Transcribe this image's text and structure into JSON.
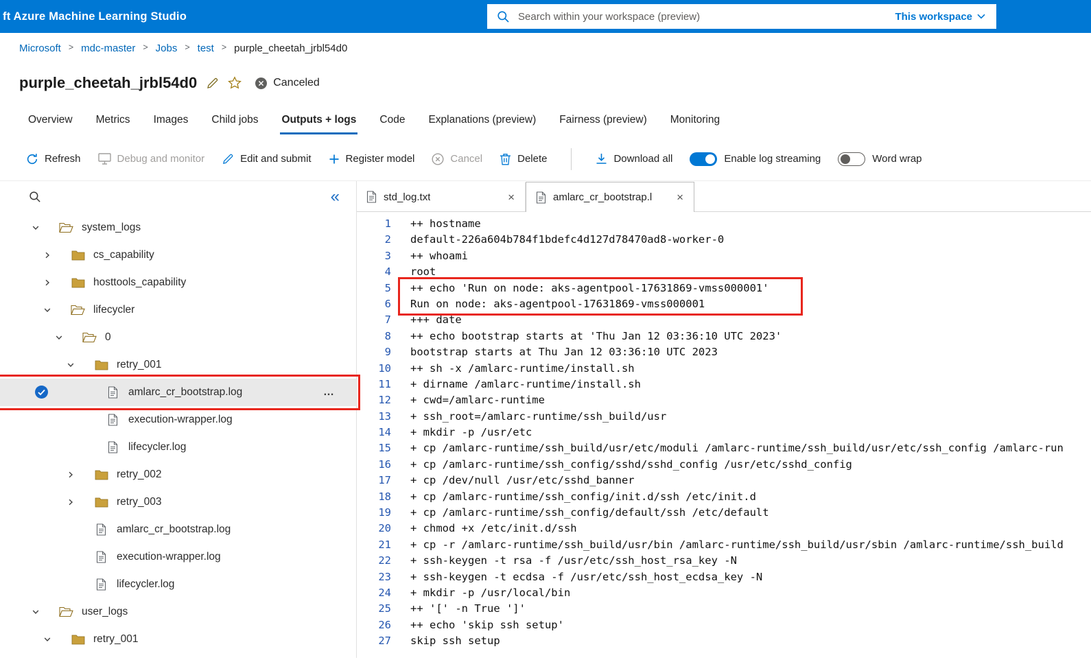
{
  "topbar": {
    "app_title": "ft Azure Machine Learning Studio",
    "search_placeholder": "Search within your workspace (preview)",
    "workspace_selector": "This workspace"
  },
  "breadcrumb": {
    "items": [
      "Microsoft",
      "mdc-master",
      "Jobs",
      "test",
      "purple_cheetah_jrbl54d0"
    ]
  },
  "header": {
    "title": "purple_cheetah_jrbl54d0",
    "status": "Canceled"
  },
  "tabs": [
    {
      "label": "Overview",
      "active": false
    },
    {
      "label": "Metrics",
      "active": false
    },
    {
      "label": "Images",
      "active": false
    },
    {
      "label": "Child jobs",
      "active": false
    },
    {
      "label": "Outputs + logs",
      "active": true
    },
    {
      "label": "Code",
      "active": false
    },
    {
      "label": "Explanations (preview)",
      "active": false
    },
    {
      "label": "Fairness (preview)",
      "active": false
    },
    {
      "label": "Monitoring",
      "active": false
    }
  ],
  "toolbar": {
    "refresh": "Refresh",
    "debug": "Debug and monitor",
    "edit": "Edit and submit",
    "register": "Register model",
    "cancel": "Cancel",
    "delete": "Delete",
    "download": "Download all",
    "log_streaming": "Enable log streaming",
    "word_wrap": "Word wrap",
    "log_streaming_on": true,
    "word_wrap_on": false
  },
  "icons": {
    "close": "×",
    "ellipsis_menu": "…",
    "collapse_double_chevron": "«",
    "breadcrumb_separator": ">"
  },
  "tree": {
    "items": [
      {
        "indent": 0,
        "chevron": "down",
        "icon": "folder",
        "open": true,
        "label": "system_logs"
      },
      {
        "indent": 1,
        "chevron": "right",
        "icon": "folder",
        "open": false,
        "label": "cs_capability"
      },
      {
        "indent": 1,
        "chevron": "right",
        "icon": "folder",
        "open": false,
        "label": "hosttools_capability"
      },
      {
        "indent": 1,
        "chevron": "down",
        "icon": "folder",
        "open": true,
        "label": "lifecycler"
      },
      {
        "indent": 2,
        "chevron": "down",
        "icon": "folder",
        "open": true,
        "label": "0"
      },
      {
        "indent": 3,
        "chevron": "down",
        "icon": "folder",
        "open": false,
        "label": "retry_001"
      },
      {
        "indent": 4,
        "chevron": "none",
        "icon": "file",
        "label": "amlarc_cr_bootstrap.log",
        "selected": true,
        "annotated": true,
        "has_menu": true
      },
      {
        "indent": 4,
        "chevron": "none",
        "icon": "file",
        "label": "execution-wrapper.log"
      },
      {
        "indent": 4,
        "chevron": "none",
        "icon": "file",
        "label": "lifecycler.log"
      },
      {
        "indent": 3,
        "chevron": "right",
        "icon": "folder",
        "open": false,
        "label": "retry_002"
      },
      {
        "indent": 3,
        "chevron": "right",
        "icon": "folder",
        "open": false,
        "label": "retry_003"
      },
      {
        "indent": 3,
        "chevron": "none",
        "icon": "file",
        "label": "amlarc_cr_bootstrap.log"
      },
      {
        "indent": 3,
        "chevron": "none",
        "icon": "file",
        "label": "execution-wrapper.log"
      },
      {
        "indent": 3,
        "chevron": "none",
        "icon": "file",
        "label": "lifecycler.log"
      },
      {
        "indent": 0,
        "chevron": "down",
        "icon": "folder",
        "open": true,
        "label": "user_logs"
      },
      {
        "indent": 1,
        "chevron": "down",
        "icon": "folder",
        "open": false,
        "label": "retry_001"
      }
    ]
  },
  "editor": {
    "tabs": [
      {
        "label": "std_log.txt",
        "active": false
      },
      {
        "label": "amlarc_cr_bootstrap.l",
        "active": true
      }
    ],
    "lines": [
      "++ hostname",
      "default-226a604b784f1bdefc4d127d78470ad8-worker-0",
      "++ whoami",
      "root",
      "++ echo 'Run on node: aks-agentpool-17631869-vmss000001'",
      "Run on node: aks-agentpool-17631869-vmss000001",
      "+++ date",
      "++ echo bootstrap starts at 'Thu Jan 12 03:36:10 UTC 2023'",
      "bootstrap starts at Thu Jan 12 03:36:10 UTC 2023",
      "++ sh -x /amlarc-runtime/install.sh",
      "+ dirname /amlarc-runtime/install.sh",
      "+ cwd=/amlarc-runtime",
      "+ ssh_root=/amlarc-runtime/ssh_build/usr",
      "+ mkdir -p /usr/etc",
      "+ cp /amlarc-runtime/ssh_build/usr/etc/moduli /amlarc-runtime/ssh_build/usr/etc/ssh_config /amlarc-run",
      "+ cp /amlarc-runtime/ssh_config/sshd/sshd_config /usr/etc/sshd_config",
      "+ cp /dev/null /usr/etc/sshd_banner",
      "+ cp /amlarc-runtime/ssh_config/init.d/ssh /etc/init.d",
      "+ cp /amlarc-runtime/ssh_config/default/ssh /etc/default",
      "+ chmod +x /etc/init.d/ssh",
      "+ cp -r /amlarc-runtime/ssh_build/usr/bin /amlarc-runtime/ssh_build/usr/sbin /amlarc-runtime/ssh_build",
      "+ ssh-keygen -t rsa -f /usr/etc/ssh_host_rsa_key -N",
      "+ ssh-keygen -t ecdsa -f /usr/etc/ssh_host_ecdsa_key -N",
      "+ mkdir -p /usr/local/bin",
      "++ '[' -n True ']'",
      "++ echo 'skip ssh setup'",
      "skip ssh setup"
    ]
  },
  "annotations": {
    "color": "#e8261d",
    "tree_item": "amlarc_cr_bootstrap.log",
    "log_lines": [
      5,
      6
    ]
  },
  "colors": {
    "accent": "#0078d4",
    "annotation_red": "#e8261d",
    "line_number_blue": "#2456b0",
    "folder_gold": "#c9a03c"
  }
}
